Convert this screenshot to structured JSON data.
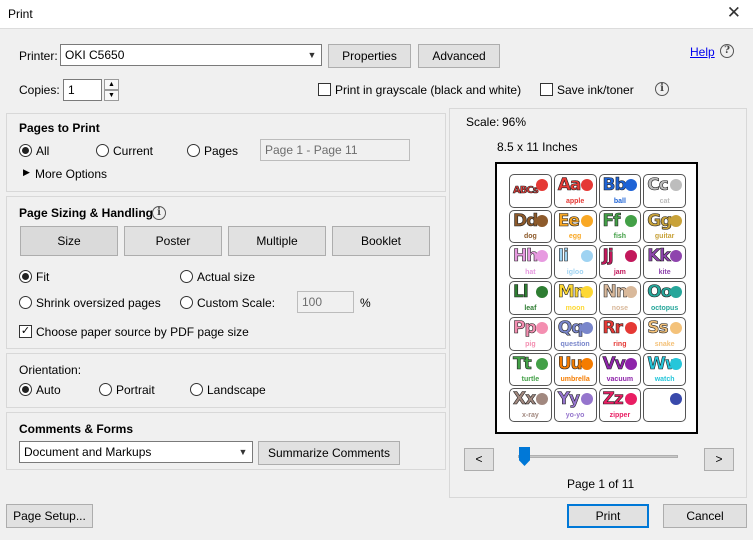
{
  "window": {
    "title": "Print"
  },
  "printer": {
    "label": "Printer:",
    "value": "OKI C5650",
    "properties_label": "Properties",
    "advanced_label": "Advanced",
    "help_label": "Help"
  },
  "copies": {
    "label": "Copies:",
    "value": "1",
    "grayscale_label": "Print in grayscale (black and white)",
    "save_ink_label": "Save ink/toner"
  },
  "pages": {
    "heading": "Pages to Print",
    "all_label": "All",
    "current_label": "Current",
    "pages_label": "Pages",
    "range_placeholder": "Page 1 - Page 11",
    "more_options_label": "More Options"
  },
  "sizing": {
    "heading": "Page Sizing & Handling",
    "tabs": [
      "Size",
      "Poster",
      "Multiple",
      "Booklet"
    ],
    "fit_label": "Fit",
    "actual_size_label": "Actual size",
    "shrink_label": "Shrink oversized pages",
    "custom_scale_label": "Custom Scale:",
    "custom_scale_value": "100",
    "percent": "%",
    "paper_source_label": "Choose paper source by PDF page size"
  },
  "orientation": {
    "heading": "Orientation:",
    "auto_label": "Auto",
    "portrait_label": "Portrait",
    "landscape_label": "Landscape"
  },
  "comments": {
    "heading": "Comments & Forms",
    "value": "Document and Markups",
    "summarize_label": "Summarize Comments"
  },
  "preview": {
    "scale_label": "Scale:",
    "scale_value": "96%",
    "paper_size": "8.5 x 11 Inches",
    "prev_label": "<",
    "next_label": ">",
    "page_indicator": "Page 1 of 11",
    "slider_fraction": 0.0,
    "cells": [
      {
        "big": "ABCs",
        "word": "",
        "color": "#e53935"
      },
      {
        "big": "Aa",
        "word": "apple",
        "color": "#e53935"
      },
      {
        "big": "Bb",
        "word": "ball",
        "color": "#1e63d6"
      },
      {
        "big": "Cc",
        "word": "cat",
        "color": "#bdbdbd"
      },
      {
        "big": "Dd",
        "word": "dog",
        "color": "#8d5a2b"
      },
      {
        "big": "Ee",
        "word": "egg",
        "color": "#f9a825"
      },
      {
        "big": "Ff",
        "word": "fish",
        "color": "#43a047"
      },
      {
        "big": "Gg",
        "word": "guitar",
        "color": "#c8a23a"
      },
      {
        "big": "Hh",
        "word": "hat",
        "color": "#e79ae0"
      },
      {
        "big": "Ii",
        "word": "igloo",
        "color": "#9fd3f2"
      },
      {
        "big": "Jj",
        "word": "jam",
        "color": "#c2185b"
      },
      {
        "big": "Kk",
        "word": "kite",
        "color": "#8e44ad"
      },
      {
        "big": "Ll",
        "word": "leaf",
        "color": "#2e7d32"
      },
      {
        "big": "Mm",
        "word": "moon",
        "color": "#fdd835"
      },
      {
        "big": "Nn",
        "word": "nose",
        "color": "#d9b99b"
      },
      {
        "big": "Oo",
        "word": "octopus",
        "color": "#26a69a"
      },
      {
        "big": "Pp",
        "word": "pig",
        "color": "#f48fb1"
      },
      {
        "big": "Qq",
        "word": "question",
        "color": "#7986cb"
      },
      {
        "big": "Rr",
        "word": "ring",
        "color": "#e53935"
      },
      {
        "big": "Ss",
        "word": "snake",
        "color": "#f4c27a"
      },
      {
        "big": "Tt",
        "word": "turtle",
        "color": "#43a047"
      },
      {
        "big": "Uu",
        "word": "umbrella",
        "color": "#f57c00"
      },
      {
        "big": "Vv",
        "word": "vacuum",
        "color": "#8e24aa"
      },
      {
        "big": "Ww",
        "word": "watch",
        "color": "#26c6da"
      },
      {
        "big": "Xx",
        "word": "x-ray",
        "color": "#a1887f"
      },
      {
        "big": "Yy",
        "word": "yo-yo",
        "color": "#9575cd"
      },
      {
        "big": "Zz",
        "word": "zipper",
        "color": "#e91e63"
      },
      {
        "big": "",
        "word": "",
        "color": "#3949ab"
      }
    ]
  },
  "footer": {
    "page_setup_label": "Page Setup...",
    "print_label": "Print",
    "cancel_label": "Cancel"
  },
  "colors": {
    "accent": "#0078d7",
    "link": "#0000ee"
  }
}
